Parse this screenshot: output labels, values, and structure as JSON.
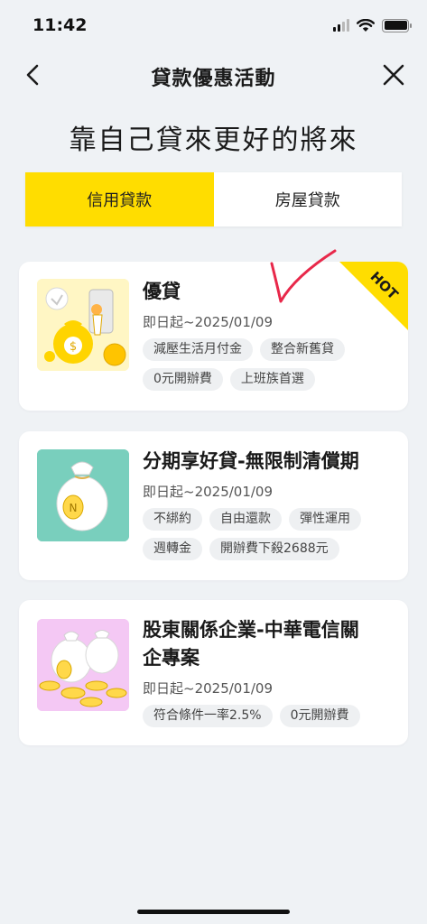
{
  "status_bar": {
    "time": "11:42"
  },
  "nav": {
    "title": "貸款優惠活動",
    "back_icon": "chevron-left-icon",
    "close_icon": "close-icon"
  },
  "headline": "靠自己貸來更好的將來",
  "tabs": [
    {
      "label": "信用貸款",
      "active": true
    },
    {
      "label": "房屋貸款",
      "active": false
    }
  ],
  "colors": {
    "accent": "#ffdd00",
    "background": "#eff2f5",
    "card": "#ffffff",
    "tag_bg": "#eef0f2",
    "annotation": "#e8284a"
  },
  "cards": [
    {
      "title": "優貸",
      "date": "即日起~2025/01/09",
      "badge": "HOT",
      "tags": [
        "減壓生活月付金",
        "整合新舊貸",
        "0元開辦費",
        "上班族首選"
      ]
    },
    {
      "title": "分期享好貸-無限制清償期",
      "date": "即日起~2025/01/09",
      "tags": [
        "不綁約",
        "自由還款",
        "彈性運用",
        "週轉金",
        "開辦費下殺2688元"
      ]
    },
    {
      "title_line1": "股東關係企業-中華電信關",
      "title_line2": "企專案",
      "date": "即日起~2025/01/09",
      "tags": [
        "符合條件一率2.5%",
        "0元開辦費"
      ]
    }
  ]
}
